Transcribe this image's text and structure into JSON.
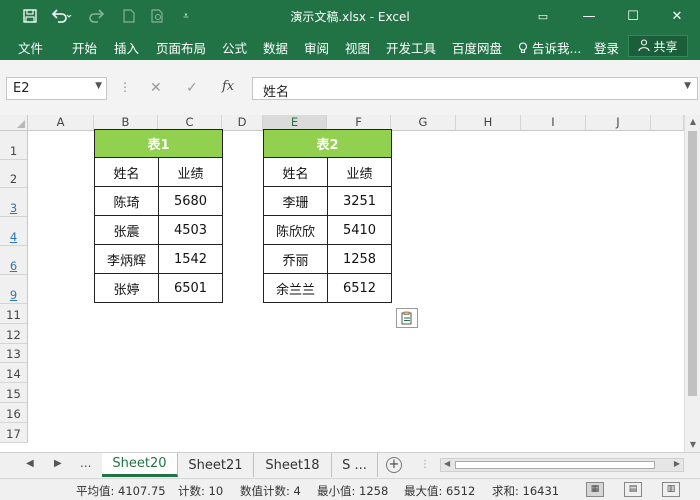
{
  "titlebar": {
    "title": "演示文稿.xlsx - Excel",
    "qat": {
      "save_icon": "save-icon",
      "undo_icon": "undo-icon",
      "redo_icon": "redo-icon",
      "new_icon": "new-file-icon",
      "preview_icon": "print-preview-icon",
      "customize_icon": "customize-qat-icon"
    },
    "window": {
      "ribbon_display": "▭",
      "minimize": "—",
      "restore": "☐",
      "close": "✕"
    }
  },
  "ribbon": {
    "tabs": [
      "文件",
      "开始",
      "插入",
      "页面布局",
      "公式",
      "数据",
      "审阅",
      "视图",
      "开发工具",
      "百度网盘"
    ],
    "tell_me": "告诉我...",
    "login": "登录",
    "share": "共享"
  },
  "formula_bar": {
    "name_box": "E2",
    "dots": "⋮",
    "cancel_icon": "✕",
    "enter_icon": "✓",
    "fx": "fx",
    "content": "姓名"
  },
  "grid": {
    "columns": [
      "A",
      "B",
      "C",
      "D",
      "E",
      "F",
      "G",
      "H",
      "I",
      "J"
    ],
    "selected_column": "E",
    "rows": [
      "1",
      "2",
      "3",
      "4",
      "6",
      "9",
      "11",
      "12",
      "13",
      "14",
      "15",
      "16",
      "17"
    ],
    "table1": {
      "title": "表1",
      "headers": [
        "姓名",
        "业绩"
      ],
      "rows": [
        [
          "陈琦",
          "5680"
        ],
        [
          "张震",
          "4503"
        ],
        [
          "李炳辉",
          "1542"
        ],
        [
          "张婷",
          "6501"
        ]
      ]
    },
    "table2": {
      "title": "表2",
      "headers": [
        "姓名",
        "业绩"
      ],
      "rows": [
        [
          "李珊",
          "3251"
        ],
        [
          "陈欣欣",
          "5410"
        ],
        [
          "乔丽",
          "1258"
        ],
        [
          "余兰兰",
          "6512"
        ]
      ]
    },
    "paste_options_icon": "paste-options-icon"
  },
  "sheet_tabs": {
    "nav_prev": "◀",
    "nav_next": "▶",
    "more": "...",
    "tabs": [
      "Sheet20",
      "Sheet21",
      "Sheet18",
      "S ..."
    ],
    "active": "Sheet20",
    "add": "+"
  },
  "status_bar": {
    "average": "平均值: 4107.75",
    "count": "计数: 10",
    "numeric_count": "数值计数: 4",
    "min": "最小值: 1258",
    "max": "最大值: 6512",
    "sum": "求和: 16431"
  },
  "colors": {
    "excel_green": "#217346",
    "header_fill": "#92d050"
  }
}
